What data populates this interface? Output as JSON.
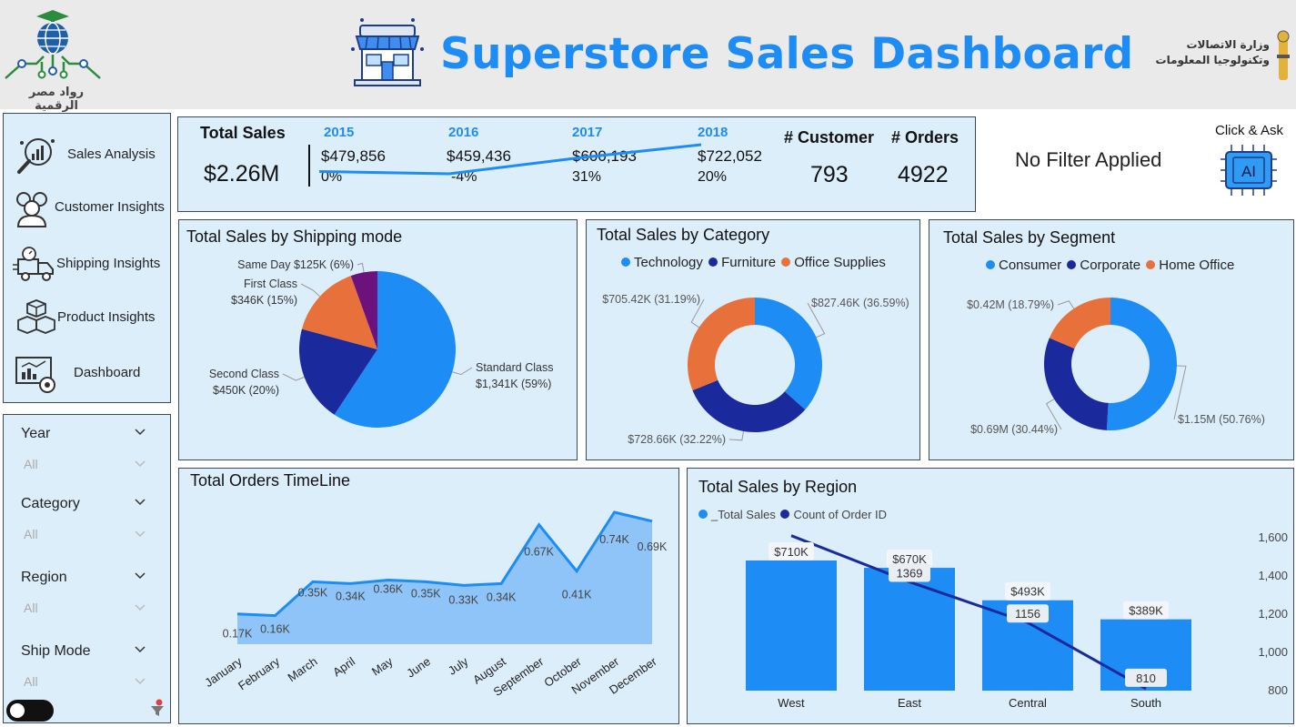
{
  "header": {
    "title": "Superstore Sales Dashboard",
    "left_logo_text": "رواد مصر الرقمية",
    "right_logo_line1": "وزارة الاتصالات",
    "right_logo_line2": "وتكنولوجيا المعلومات"
  },
  "nav": {
    "items": [
      {
        "label": "Sales Analysis",
        "icon": "magnifier-chart-icon"
      },
      {
        "label": "Customer Insights",
        "icon": "people-icon"
      },
      {
        "label": "Shipping Insights",
        "icon": "delivery-truck-icon"
      },
      {
        "label": "Product Insights",
        "icon": "boxes-icon"
      },
      {
        "label": "Dashboard",
        "icon": "dashboard-icon"
      }
    ]
  },
  "filters": {
    "items": [
      {
        "label": "Year",
        "value": "All"
      },
      {
        "label": "Category",
        "value": "All"
      },
      {
        "label": "Region",
        "value": "All"
      },
      {
        "label": "Ship Mode",
        "value": "All"
      }
    ]
  },
  "kpi": {
    "title": "Total Sales",
    "total": "$2.26M",
    "years": [
      {
        "year": "2015",
        "value": "$479,856",
        "pct": "0%"
      },
      {
        "year": "2016",
        "value": "$459,436",
        "pct": "-4%"
      },
      {
        "year": "2017",
        "value": "$600,193",
        "pct": "31%"
      },
      {
        "year": "2018",
        "value": "$722,052",
        "pct": "20%"
      }
    ],
    "customers_label": "# Customer",
    "customers": "793",
    "orders_label": "# Orders",
    "orders": "4922"
  },
  "status": {
    "no_filter": "No Filter Applied",
    "ask_label": "Click & Ask",
    "ai_text": "AI"
  },
  "colors": {
    "blue": "#1e8cf5",
    "dark_blue": "#1a2a9c",
    "orange": "#e8703a",
    "purple": "#6b127d",
    "light_fill": "#8ec4f8",
    "panel_bg": "#ddeefb"
  },
  "chart_data": [
    {
      "id": "shipping",
      "type": "pie",
      "title": "Total Sales by Shipping mode",
      "slices": [
        {
          "name": "Standard Class",
          "value": 1341,
          "label1": "Standard Class",
          "label2": "$1,341K (59%)"
        },
        {
          "name": "Second Class",
          "value": 450,
          "label1": "Second Class",
          "label2": "$450K (20%)"
        },
        {
          "name": "First Class",
          "value": 346,
          "label1": "First Class",
          "label2": "$346K (15%)"
        },
        {
          "name": "Same Day",
          "value": 125,
          "label1": "Same Day $125K (6%)",
          "label2": ""
        }
      ]
    },
    {
      "id": "category",
      "type": "pie",
      "title": "Total Sales by Category",
      "legend": [
        "Technology",
        "Furniture",
        "Office Supplies"
      ],
      "slices": [
        {
          "name": "Technology",
          "value": 827.46,
          "label": "$827.46K (36.59%)"
        },
        {
          "name": "Furniture",
          "value": 728.66,
          "label": "$728.66K (32.22%)"
        },
        {
          "name": "Office Supplies",
          "value": 705.42,
          "label": "$705.42K (31.19%)"
        }
      ]
    },
    {
      "id": "segment",
      "type": "pie",
      "title": "Total Sales by Segment",
      "legend": [
        "Consumer",
        "Corporate",
        "Home Office"
      ],
      "slices": [
        {
          "name": "Consumer",
          "value": 1.15,
          "label": "$1.15M (50.76%)"
        },
        {
          "name": "Corporate",
          "value": 0.69,
          "label": "$0.69M (30.44%)"
        },
        {
          "name": "Home Office",
          "value": 0.42,
          "label": "$0.42M (18.79%)"
        }
      ]
    },
    {
      "id": "timeline",
      "type": "area",
      "title": "Total Orders TimeLine",
      "categories": [
        "January",
        "February",
        "March",
        "April",
        "May",
        "June",
        "July",
        "August",
        "September",
        "October",
        "November",
        "December"
      ],
      "values": [
        0.17,
        0.16,
        0.35,
        0.34,
        0.36,
        0.35,
        0.33,
        0.34,
        0.67,
        0.41,
        0.74,
        0.69
      ],
      "labels": [
        "0.17K",
        "0.16K",
        "0.35K",
        "0.34K",
        "0.36K",
        "0.35K",
        "0.33K",
        "0.34K",
        "0.67K",
        "0.41K",
        "0.74K",
        "0.69K"
      ]
    },
    {
      "id": "region",
      "type": "bar",
      "title": "Total Sales by Region",
      "legend": [
        "_Total Sales",
        "Count of Order ID"
      ],
      "categories": [
        "West",
        "East",
        "Central",
        "South"
      ],
      "series": [
        {
          "name": "_Total Sales",
          "values": [
            710,
            670,
            493,
            389
          ],
          "labels": [
            "$710K",
            "$670K",
            "$493K",
            "$389K"
          ]
        },
        {
          "name": "Count of Order ID",
          "values": [
            1611,
            1369,
            1156,
            810
          ],
          "labels": [
            "",
            "1369",
            "1156",
            "810"
          ]
        }
      ],
      "y2_ticks": [
        "1,600",
        "1,400",
        "1,200",
        "1,000",
        "800"
      ],
      "y2lim": [
        800,
        1600
      ]
    }
  ]
}
